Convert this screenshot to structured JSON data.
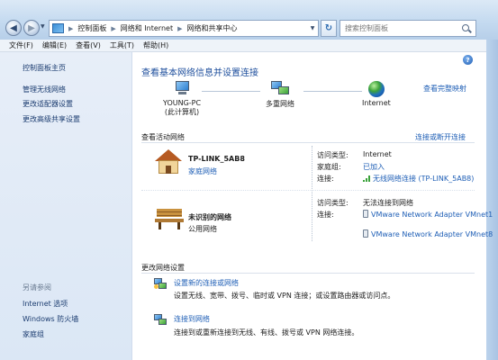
{
  "address": {
    "crumbs": [
      "控制面板",
      "网络和 Internet",
      "网络和共享中心"
    ],
    "search_placeholder": "搜索控制面板"
  },
  "menu": [
    "文件(F)",
    "编辑(E)",
    "查看(V)",
    "工具(T)",
    "帮助(H)"
  ],
  "sidebar": {
    "home": "控制面板主页",
    "links": [
      "管理无线网络",
      "更改适配器设置",
      "更改高级共享设置"
    ],
    "see_also_title": "另请参阅",
    "see_also": [
      "Internet 选项",
      "Windows 防火墙",
      "家庭组"
    ]
  },
  "main": {
    "title": "查看基本网络信息并设置连接",
    "full_map_link": "查看完整映射",
    "map": {
      "computer_name": "YOUNG-PC",
      "computer_sub": "(此计算机)",
      "multi_network": "多重网络",
      "internet": "Internet"
    },
    "active_networks_label": "查看活动网络",
    "connect_disconnect_link": "连接或断开连接",
    "networks": [
      {
        "name": "TP-LINK_5AB8",
        "type": "家庭网络",
        "access_type_label": "访问类型:",
        "access_type": "Internet",
        "homegroup_label": "家庭组:",
        "homegroup": "已加入",
        "connection_label": "连接:",
        "connection": "无线网络连接 (TP-LINK_5AB8)"
      },
      {
        "name": "未识别的网络",
        "type": "公用网络",
        "access_type_label": "访问类型:",
        "access_type": "无法连接到网络",
        "connection_label": "连接:",
        "connections": [
          "VMware Network Adapter VMnet1",
          "VMware Network Adapter VMnet8"
        ]
      }
    ],
    "change_settings_label": "更改网络设置",
    "tasks": [
      {
        "link": "设置新的连接或网络",
        "desc": "设置无线、宽带、拨号、临时或 VPN 连接；或设置路由器或访问点。"
      },
      {
        "link": "连接到网络",
        "desc": "连接到或重新连接到无线、有线、拨号或 VPN 网络连接。"
      }
    ]
  }
}
